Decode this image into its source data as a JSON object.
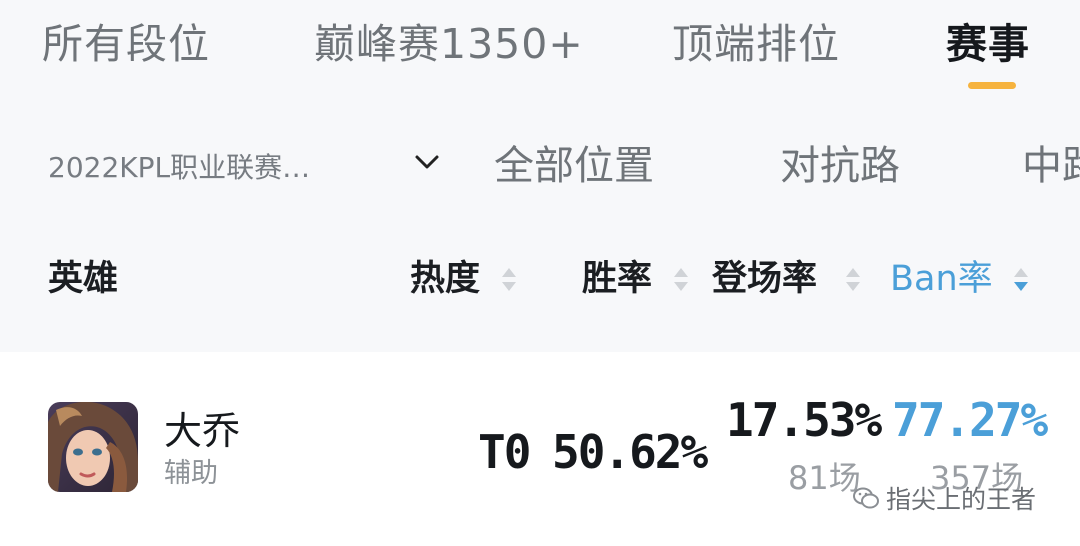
{
  "tabs": [
    {
      "label": "所有段位"
    },
    {
      "label": "巅峰赛1350+"
    },
    {
      "label": "顶端排位"
    },
    {
      "label": "赛事"
    }
  ],
  "active_tab": "赛事",
  "filters": {
    "season": "2022KPL职业联赛…",
    "positions": [
      "全部位置",
      "对抗路",
      "中路"
    ]
  },
  "columns": {
    "hero": "英雄",
    "heat": "热度",
    "win_rate": "胜率",
    "pick_rate": "登场率",
    "ban_rate": "Ban率"
  },
  "active_sort": "Ban率",
  "colors": {
    "accent": "#f6b33e",
    "sort_active": "#4b9fd8",
    "text_primary": "#16191d",
    "text_secondary": "#8d9297"
  },
  "rows": [
    {
      "name": "大乔",
      "role": "辅助",
      "tier": "T0",
      "win_rate": "50.62%",
      "pick_rate": "17.53%",
      "pick_count": "81场",
      "ban_rate": "77.27%",
      "ban_count": "357场"
    }
  ],
  "watermark": {
    "icon": "wechat-icon",
    "text": "指尖上的王者"
  }
}
